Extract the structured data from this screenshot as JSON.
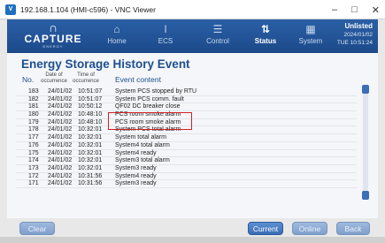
{
  "window": {
    "title": "192.168.1.104 (HMI-c596) - VNC Viewer",
    "icon": "vnc-icon",
    "minimize": "–",
    "maximize": "□",
    "close": "✕"
  },
  "header": {
    "logo_text": "CAPTURE",
    "logo_sub": "ENERGY",
    "nav": [
      {
        "label": "Home",
        "icon": "home-icon",
        "glyph": "⌂",
        "active": false
      },
      {
        "label": "ECS",
        "icon": "thermometer-icon",
        "glyph": "🌡",
        "active": false
      },
      {
        "label": "Control",
        "icon": "list-icon",
        "glyph": "☰",
        "active": false
      },
      {
        "label": "Status",
        "icon": "sliders-icon",
        "glyph": "⇅",
        "active": true
      },
      {
        "label": "System",
        "icon": "grid-icon",
        "glyph": "▦",
        "active": false
      }
    ],
    "status": "Unlisted",
    "date": "2024/01/02",
    "time": "TUE 10:51:24"
  },
  "page": {
    "title": "Energy Storage History Event",
    "columns": {
      "no": "No.",
      "date": "Date of occurrence",
      "time": "Time of occurrence",
      "event": "Event content"
    }
  },
  "events": [
    {
      "no": "183",
      "date": "24/01/02",
      "time": "10:51:07",
      "event": "System PCS stopped by RTU"
    },
    {
      "no": "182",
      "date": "24/01/02",
      "time": "10:51:07",
      "event": "System PCS comm. fault"
    },
    {
      "no": "181",
      "date": "24/01/02",
      "time": "10:50:12",
      "event": "QF02 DC breaker close"
    },
    {
      "no": "180",
      "date": "24/01/02",
      "time": "10:48:10",
      "event": "PCS room smoke alarm"
    },
    {
      "no": "179",
      "date": "24/01/02",
      "time": "10:48:10",
      "event": "PCS room smoke alarm"
    },
    {
      "no": "178",
      "date": "24/01/02",
      "time": "10:32:01",
      "event": "System PCS total alarm"
    },
    {
      "no": "177",
      "date": "24/01/02",
      "time": "10:32:01",
      "event": "System total alarm"
    },
    {
      "no": "176",
      "date": "24/01/02",
      "time": "10:32:01",
      "event": "System4 total alarm"
    },
    {
      "no": "175",
      "date": "24/01/02",
      "time": "10:32:01",
      "event": "System4 ready"
    },
    {
      "no": "174",
      "date": "24/01/02",
      "time": "10:32:01",
      "event": "System3 total alarm"
    },
    {
      "no": "173",
      "date": "24/01/02",
      "time": "10:32:01",
      "event": "System3 ready"
    },
    {
      "no": "172",
      "date": "24/01/02",
      "time": "10:31:56",
      "event": "System4 ready"
    },
    {
      "no": "171",
      "date": "24/01/02",
      "time": "10:31:56",
      "event": "System3 ready"
    }
  ],
  "buttons": {
    "clear": "Clear",
    "current": "Current",
    "online": "Online",
    "back": "Back"
  }
}
